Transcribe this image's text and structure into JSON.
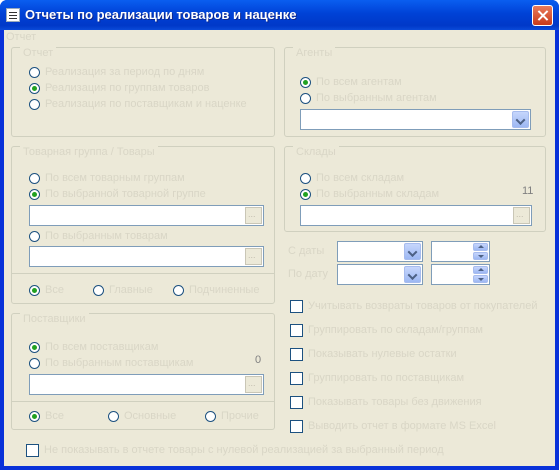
{
  "window": {
    "title": "Отчеты по реализации товаров и наценке"
  },
  "top_label": "Отчет",
  "group_period": {
    "legend": "Отчет",
    "options": [
      "Реализация за период по дням",
      "Реализация по группам товаров",
      "Реализация по поставщикам и наценке"
    ],
    "selected": 1
  },
  "group_agents": {
    "legend": "Агенты",
    "options": [
      "По всем агентам",
      "По выбранным агентам"
    ],
    "selected": 0,
    "combo_value": ""
  },
  "group_goods": {
    "legend": "Товарная группа / Товары",
    "options": [
      "По всем товарным группам",
      "По выбранной товарной группе",
      "По выбранным товарам"
    ],
    "selected": 1,
    "field1_value": "",
    "field2_value": "",
    "sub_options": [
      "Все",
      "Главные",
      "Подчиненные"
    ],
    "sub_selected": 0
  },
  "group_stores": {
    "legend": "Склады",
    "options": [
      "По всем складам",
      "По выбранным складам"
    ],
    "selected": 1,
    "count": "11",
    "field_value": ""
  },
  "date_from": {
    "label": "С даты",
    "date": "",
    "time": ""
  },
  "date_to": {
    "label": "По дату",
    "date": "",
    "time": ""
  },
  "group_suppliers": {
    "legend": "Поставщики",
    "options": [
      "По всем поставщикам",
      "По выбранным поставщикам"
    ],
    "selected": 0,
    "count": "0",
    "field_value": "",
    "sub_options": [
      "Все",
      "Основные",
      "Прочие"
    ],
    "sub_selected": 0
  },
  "checkboxes": [
    "Учитывать возвраты товаров от покупателей",
    "Группировать по складам/группам",
    "Показывать нулевые остатки",
    "Группировать по поставщикам",
    "Показывать товары без движения",
    "Выводить отчет в формате MS Excel"
  ],
  "bottom_checkbox": "Не показывать в отчете товары с нулевой реализацией за выбранный период"
}
